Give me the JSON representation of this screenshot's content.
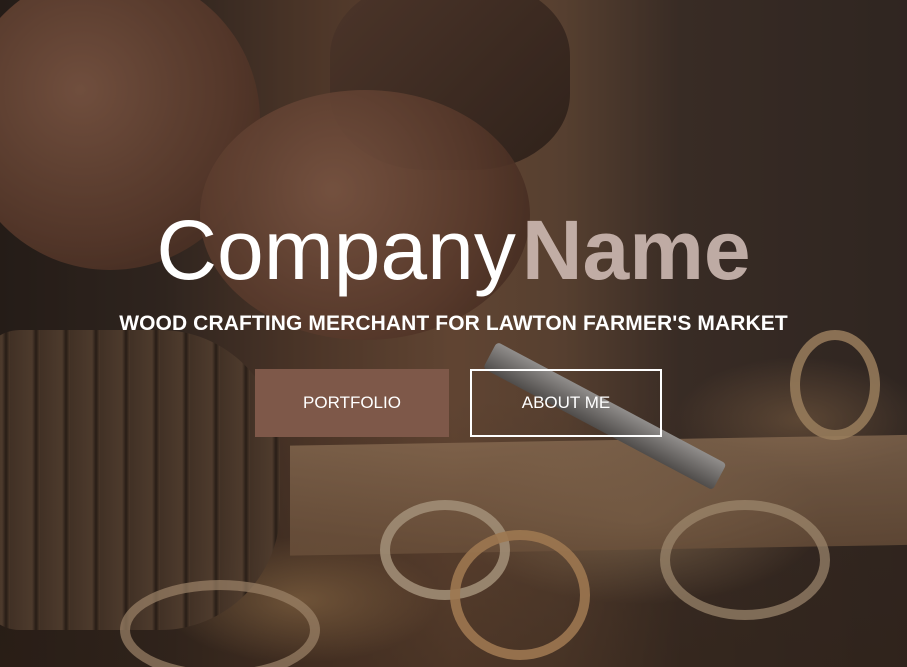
{
  "hero": {
    "title_part1": "Company",
    "title_part2": "Name",
    "tagline": "WOOD CRAFTING MERCHANT FOR LAWTON FARMER'S MARKET",
    "buttons": {
      "portfolio": "PORTFOLIO",
      "about": "ABOUT ME"
    }
  },
  "colors": {
    "primary_button": "#7e5849",
    "outline_button_border": "#ffffff",
    "title_accent": "#cdb9b2"
  }
}
